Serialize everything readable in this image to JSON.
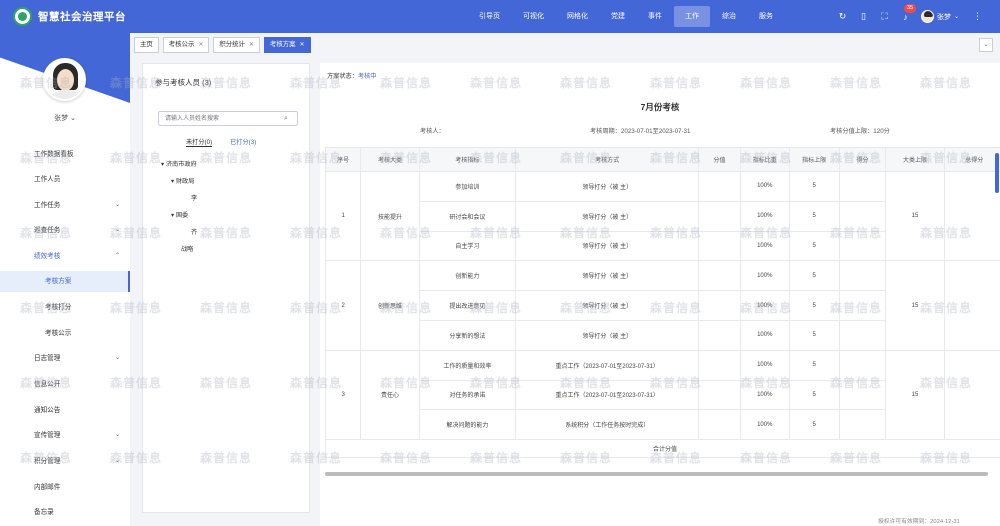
{
  "app": {
    "title": "智慧社会治理平台"
  },
  "nav": [
    "引导页",
    "可视化",
    "网格化",
    "党建",
    "事件",
    "工作",
    "综治",
    "服务"
  ],
  "nav_active": 5,
  "header": {
    "notif_count": "35",
    "user": "张梦"
  },
  "sidebar": {
    "user": "张梦",
    "items": [
      {
        "label": "工作数据看板"
      },
      {
        "label": "工作人员"
      },
      {
        "label": "工作任务",
        "arrow": "⌄"
      },
      {
        "label": "巡查任务",
        "arrow": "⌄"
      },
      {
        "label": "绩效考核",
        "arrow": "⌃"
      },
      {
        "label": "考核方案"
      },
      {
        "label": "考核打分"
      },
      {
        "label": "考核公示"
      },
      {
        "label": "日志管理",
        "arrow": "⌄"
      },
      {
        "label": "信息公开"
      },
      {
        "label": "通知公告"
      },
      {
        "label": "宣传管理",
        "arrow": "⌄"
      },
      {
        "label": "积分管理",
        "arrow": "⌄"
      },
      {
        "label": "内部邮件"
      },
      {
        "label": "备忘录"
      }
    ]
  },
  "tabs": [
    {
      "label": "主页"
    },
    {
      "label": "考核公示"
    },
    {
      "label": "积分统计"
    },
    {
      "label": "考核方案"
    }
  ],
  "panel": {
    "title": "参与考核人员  (3)",
    "search_placeholder": "请输入人员姓名搜索",
    "tab_unscored": "未打分(0)",
    "tab_scored": "已打分(3)",
    "tree": [
      "济南市政府",
      "财政局",
      "李",
      "国委",
      "齐",
      "战略"
    ]
  },
  "main": {
    "status_label": "方案状态：",
    "status_value": "考核中",
    "title": "7月份考核",
    "examiner": "考核人：",
    "period": "考核周期：2023-07-01至2023-07-31",
    "score_limit": "考核分值上限：120分",
    "columns": [
      "序号",
      "考核大类",
      "考核指标",
      "考核方式",
      "分值",
      "指标比重",
      "指标上限",
      "得分",
      "大类上限",
      "总得分"
    ],
    "rows": [
      {
        "seq": "1",
        "cat": "技能提升",
        "indicator": "参加培训",
        "method": "领导打分（被   主）",
        "ratio": "100%",
        "limit": "5",
        "cat_limit": "15"
      },
      {
        "indicator": "研讨会和会议",
        "method": "领导打分（被   主）",
        "ratio": "100%",
        "limit": "5"
      },
      {
        "indicator": "自主学习",
        "method": "领导打分（被   主）",
        "ratio": "100%",
        "limit": "5"
      },
      {
        "seq": "2",
        "cat": "创新思维",
        "indicator": "创新能力",
        "method": "领导打分（被   主）",
        "ratio": "100%",
        "limit": "5",
        "cat_limit": "15"
      },
      {
        "indicator": "提出改进意见",
        "method": "领导打分（被   主）",
        "ratio": "100%",
        "limit": "5"
      },
      {
        "indicator": "分享新的想法",
        "method": "领导打分（被   主）",
        "ratio": "100%",
        "limit": "5"
      },
      {
        "seq": "3",
        "cat": "责任心",
        "indicator": "工作的质量和效率",
        "method": "重点工作（2023-07-01至2023-07-31）",
        "ratio": "100%",
        "limit": "5",
        "cat_limit": "15"
      },
      {
        "indicator": "对任务的承诺",
        "method": "重点工作（2023-07-01至2023-07-31）",
        "ratio": "100%",
        "limit": "5"
      },
      {
        "indicator": "解决问题的能力",
        "method": "系统积分（工作任务按时完成）",
        "ratio": "100%",
        "limit": "5"
      }
    ],
    "total_label": "合计分值"
  },
  "footer": "授权许可有效期到：2024-12-31",
  "watermark": "森普信息"
}
